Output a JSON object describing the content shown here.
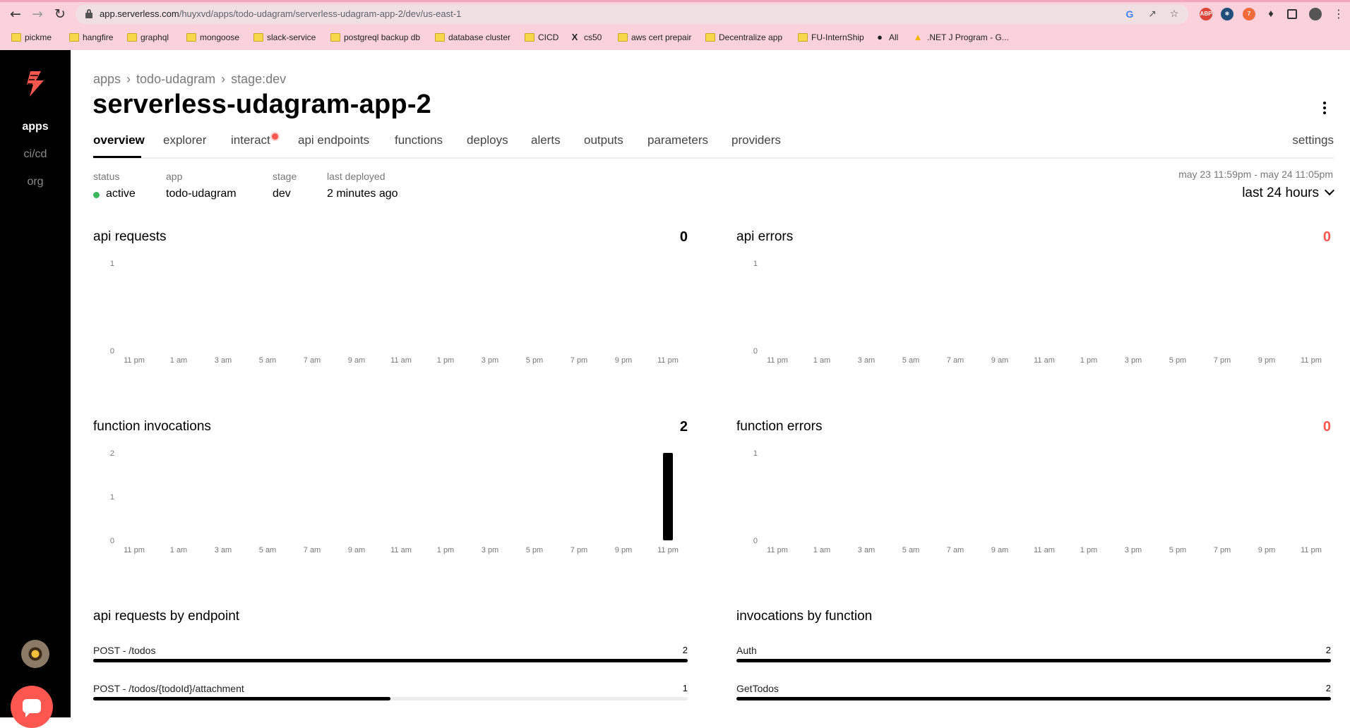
{
  "browser": {
    "url_host": "app.serverless.com",
    "url_path": "/huyxvd/apps/todo-udagram/serverless-udagram-app-2/dev/us-east-1",
    "bookmarks": [
      {
        "label": "pickme",
        "icon": "folder-icon"
      },
      {
        "label": "hangfire",
        "icon": "folder-icon"
      },
      {
        "label": "graphql",
        "icon": "folder-icon"
      },
      {
        "label": "mongoose",
        "icon": "folder-icon"
      },
      {
        "label": "slack-service",
        "icon": "folder-icon"
      },
      {
        "label": "postgreql backup db",
        "icon": "folder-icon"
      },
      {
        "label": "database cluster",
        "icon": "folder-icon"
      },
      {
        "label": "CICD",
        "icon": "folder-icon"
      },
      {
        "label": "cs50",
        "icon": "x-logo-icon"
      },
      {
        "label": "aws cert prepair",
        "icon": "folder-icon"
      },
      {
        "label": "Decentralize app",
        "icon": "folder-icon"
      },
      {
        "label": "FU-InternShip",
        "icon": "folder-icon"
      },
      {
        "label": "All",
        "icon": "globe-icon"
      },
      {
        "label": ".NET J Program - G...",
        "icon": "drive-icon"
      }
    ]
  },
  "rail": {
    "items": [
      {
        "label": "apps",
        "active": true
      },
      {
        "label": "ci/cd",
        "active": false
      },
      {
        "label": "org",
        "active": false
      }
    ]
  },
  "header": {
    "breadcrumbs": [
      "apps",
      "todo-udagram",
      "stage:dev"
    ],
    "title": "serverless-udagram-app-2"
  },
  "tabs": [
    "overview",
    "explorer",
    "interact",
    "api endpoints",
    "functions",
    "deploys",
    "alerts",
    "outputs",
    "parameters",
    "providers"
  ],
  "settings_label": "settings",
  "meta": {
    "status_label": "status",
    "status_value": "active",
    "app_label": "app",
    "app_value": "todo-udagram",
    "stage_label": "stage",
    "stage_value": "dev",
    "deployed_label": "last deployed",
    "deployed_value": "2 minutes ago"
  },
  "time_range": {
    "span": "may 23 11:59pm - may 24 11:05pm",
    "selected": "last 24 hours"
  },
  "colors": {
    "accent": "#fd5750",
    "status_active": "#3bb85c",
    "bar": "#000000"
  },
  "chart_data": [
    {
      "type": "bar",
      "title": "api requests",
      "total": "0",
      "x": [
        "11 pm",
        "1 am",
        "3 am",
        "5 am",
        "7 am",
        "9 am",
        "11 am",
        "1 pm",
        "3 pm",
        "5 pm",
        "7 pm",
        "9 pm",
        "11 pm"
      ],
      "yticks": [
        "1",
        "0"
      ],
      "ylim": [
        0,
        1
      ],
      "bars": []
    },
    {
      "type": "bar",
      "title": "api errors",
      "total": "0",
      "x": [
        "11 pm",
        "1 am",
        "3 am",
        "5 am",
        "7 am",
        "9 am",
        "11 am",
        "1 pm",
        "3 pm",
        "5 pm",
        "7 pm",
        "9 pm",
        "11 pm"
      ],
      "yticks": [
        "1",
        "0"
      ],
      "ylim": [
        0,
        1
      ],
      "bars": []
    },
    {
      "type": "bar",
      "title": "function invocations",
      "total": "2",
      "x": [
        "11 pm",
        "1 am",
        "3 am",
        "5 am",
        "7 am",
        "9 am",
        "11 am",
        "1 pm",
        "3 pm",
        "5 pm",
        "7 pm",
        "9 pm",
        "11 pm"
      ],
      "yticks": [
        "2",
        "1",
        "0"
      ],
      "ylim": [
        0,
        2
      ],
      "bars": [
        {
          "x": "11 pm",
          "value": 2
        }
      ]
    },
    {
      "type": "bar",
      "title": "function errors",
      "total": "0",
      "x": [
        "11 pm",
        "1 am",
        "3 am",
        "5 am",
        "7 am",
        "9 am",
        "11 am",
        "1 pm",
        "3 pm",
        "5 pm",
        "7 pm",
        "9 pm",
        "11 pm"
      ],
      "yticks": [
        "1",
        "0"
      ],
      "ylim": [
        0,
        1
      ],
      "bars": []
    }
  ],
  "breakdowns": {
    "endpoints": {
      "title": "api requests by endpoint",
      "max": 2,
      "rows": [
        {
          "label": "POST - /todos",
          "count": 2
        },
        {
          "label": "POST - /todos/{todoId}/attachment",
          "count": 1
        }
      ]
    },
    "functions": {
      "title": "invocations by function",
      "max": 2,
      "rows": [
        {
          "label": "Auth",
          "count": 2
        },
        {
          "label": "GetTodos",
          "count": 2
        }
      ]
    }
  }
}
